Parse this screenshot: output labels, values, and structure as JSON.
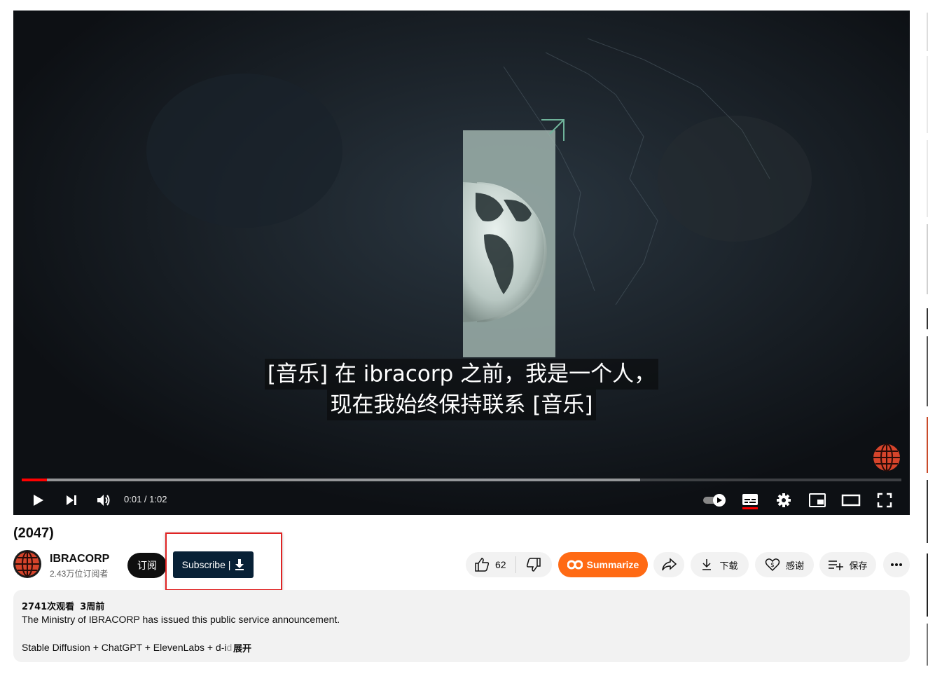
{
  "video": {
    "subtitle_line1": "[音乐] 在 ibracorp 之前，我是一个人，",
    "subtitle_line2": "现在我始终保持联系 [音乐]",
    "time": "0:01 / 1:02",
    "progress_played": 0.029,
    "progress_buffered": 0.703
  },
  "title": "(2047)",
  "channel": {
    "name": "IBRACORP",
    "subscribers": "2.43万位订阅者",
    "subscribe_label": "订阅",
    "extension_subscribe_label": "Subscribe |"
  },
  "actions": {
    "likes": "62",
    "summarize": "Summarize",
    "download": "下载",
    "thanks": "感谢",
    "save": "保存"
  },
  "description": {
    "views": "2741次观看",
    "age": "3周前",
    "line1": "The Ministry of IBRACORP has issued this public service announcement.",
    "line2": "Stable Diffusion + ChatGPT + ElevenLabs + d-i",
    "line2_fade": "d",
    "expand": "展开"
  },
  "colors": {
    "accent_red": "#ff0000",
    "summarize_orange": "#ff6a14",
    "extension_button": "#082136",
    "highlight_box": "#e02424"
  }
}
